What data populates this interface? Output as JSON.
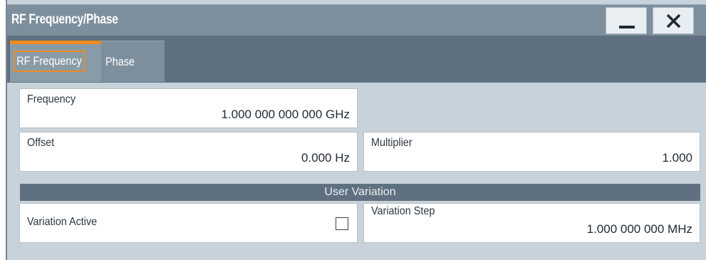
{
  "window": {
    "title": "RF Frequency/Phase",
    "minimize_icon": "minimize-icon",
    "close_icon": "close-icon"
  },
  "tabs": [
    {
      "label": "RF Frequency",
      "active": true
    },
    {
      "label": "Phase",
      "active": false
    }
  ],
  "fields": {
    "frequency": {
      "label": "Frequency",
      "value": "1.000 000 000 000 GHz"
    },
    "offset": {
      "label": "Offset",
      "value": "0.000 Hz"
    },
    "multiplier": {
      "label": "Multiplier",
      "value": "1.000"
    },
    "variation_active": {
      "label": "Variation Active",
      "checked": false
    },
    "variation_step": {
      "label": "Variation Step",
      "value": "1.000 000 000 MHz"
    }
  },
  "section": {
    "user_variation": "User Variation"
  },
  "colors": {
    "accent": "#f08b1d",
    "titlebar": "#7d8f9d",
    "tabbar": "#5f7180",
    "panel": "#c7d2da"
  }
}
